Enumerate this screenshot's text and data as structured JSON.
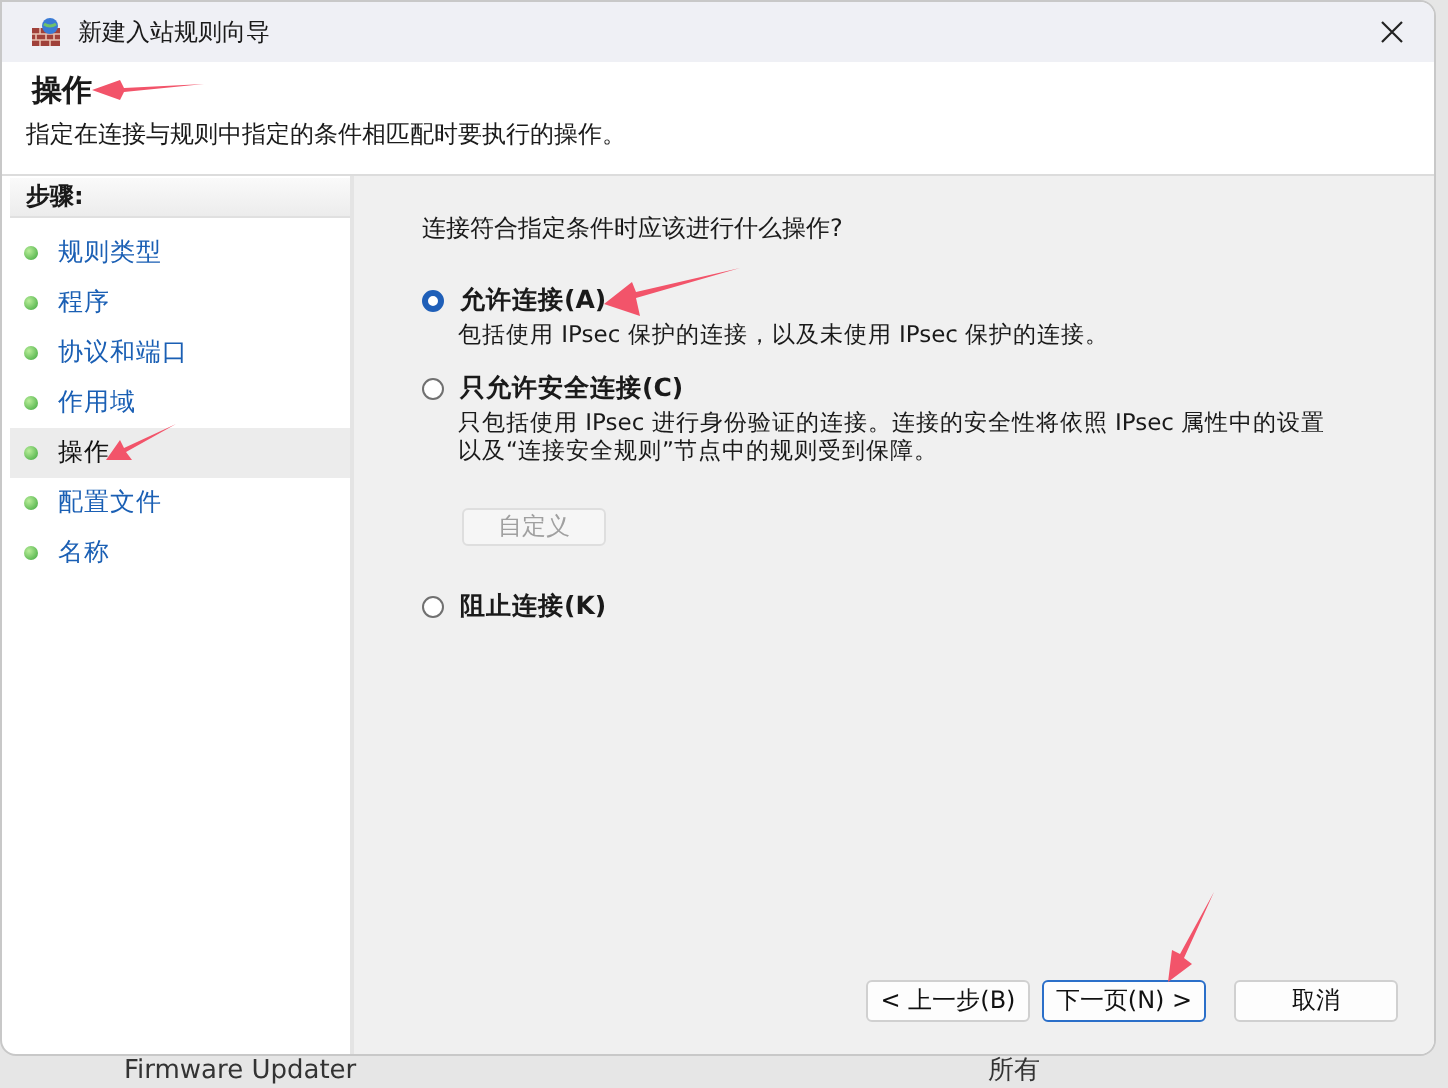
{
  "window": {
    "title": "新建入站规则向导"
  },
  "header": {
    "title": "操作",
    "description": "指定在连接与规则中指定的条件相匹配时要执行的操作。"
  },
  "steps": {
    "heading": "步骤:",
    "items": [
      {
        "label": "规则类型",
        "selected": false
      },
      {
        "label": "程序",
        "selected": false
      },
      {
        "label": "协议和端口",
        "selected": false
      },
      {
        "label": "作用域",
        "selected": false
      },
      {
        "label": "操作",
        "selected": true
      },
      {
        "label": "配置文件",
        "selected": false
      },
      {
        "label": "名称",
        "selected": false
      }
    ]
  },
  "question": "连接符合指定条件时应该进行什么操作?",
  "options": [
    {
      "label": "允许连接(A)",
      "description": "包括使用 IPsec 保护的连接，以及未使用 IPsec 保护的连接。",
      "selected": true
    },
    {
      "label": "只允许安全连接(C)",
      "description": "只包括使用 IPsec 进行身份验证的连接。连接的安全性将依照 IPsec 属性中的设置以及“连接安全规则”节点中的规则受到保障。",
      "selected": false,
      "button": {
        "label": "自定义",
        "disabled": true
      }
    },
    {
      "label": "阻止连接(K)",
      "selected": false
    }
  ],
  "buttons": [
    {
      "label": "< 上一步(B)",
      "default": false
    },
    {
      "label": "下一页(N) >",
      "default": true
    },
    {
      "label": "取消",
      "default": false
    }
  ],
  "background_row": {
    "name": "Firmware Updater",
    "column_2": "所有"
  }
}
